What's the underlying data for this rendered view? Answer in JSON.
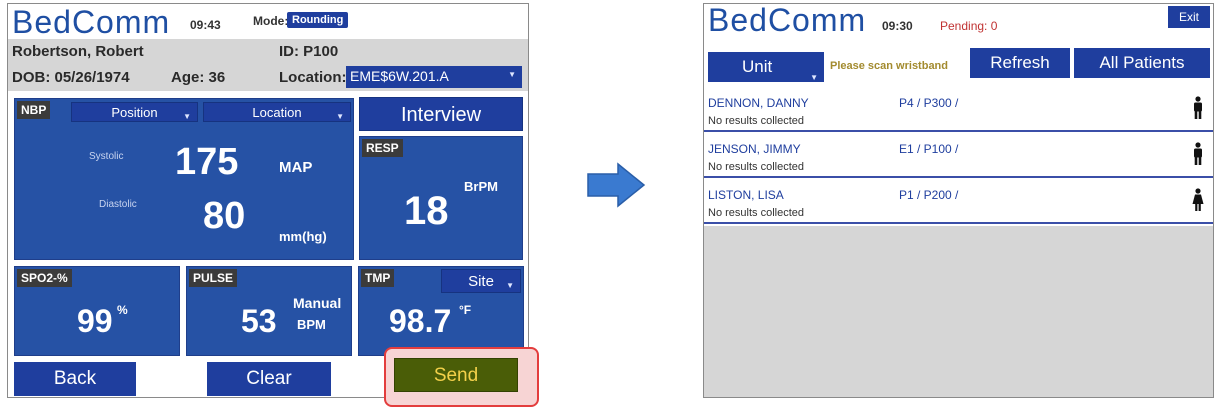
{
  "screen1": {
    "logo": "BedComm",
    "time": "09:43",
    "mode_label": "Mode:",
    "mode_value": "Rounding",
    "patient": {
      "name": "Robertson, Robert",
      "id": "ID: P100",
      "dob": "DOB: 05/26/1974",
      "age": "Age: 36",
      "location_label": "Location:",
      "location_value": "EME$6W.201.A"
    },
    "nbp": {
      "tag": "NBP",
      "position": "Position",
      "location": "Location",
      "systolic_label": "Systolic",
      "diastolic_label": "Diastolic",
      "systolic": "175",
      "diastolic": "80",
      "map_label": "MAP",
      "unit": "mm(hg)"
    },
    "interview": "Interview",
    "resp": {
      "tag": "RESP",
      "value": "18",
      "unit": "BrPM"
    },
    "spo2": {
      "tag": "SPO2-%",
      "value": "99",
      "unit": "%"
    },
    "pulse": {
      "tag": "PULSE",
      "value": "53",
      "manual": "Manual",
      "unit": "BPM"
    },
    "tmp": {
      "tag": "TMP",
      "site": "Site",
      "value": "98.7",
      "unit": "°F"
    },
    "buttons": {
      "back": "Back",
      "clear": "Clear",
      "send": "Send"
    }
  },
  "screen2": {
    "logo": "BedComm",
    "time": "09:30",
    "pending": "Pending: 0",
    "exit": "Exit",
    "unit": "Unit",
    "scan_note": "Please scan wristband",
    "refresh": "Refresh",
    "all_patients": "All Patients",
    "patients": [
      {
        "name": "DENNON, DANNY",
        "bed": "P4 / P300 /",
        "result": "No results collected",
        "icon": "male-icon"
      },
      {
        "name": "JENSON, JIMMY",
        "bed": "E1 / P100 /",
        "result": "No results collected",
        "icon": "male-icon"
      },
      {
        "name": "LISTON, LISA",
        "bed": "P1 / P200 /",
        "result": "No results collected",
        "icon": "female-icon"
      }
    ]
  },
  "colors": {
    "accent_blue": "#1f3e9e",
    "panel_blue": "#2652a5",
    "send_green": "#4a5d07",
    "highlight_red": "#e33d3d",
    "pending_red": "#c03232"
  }
}
